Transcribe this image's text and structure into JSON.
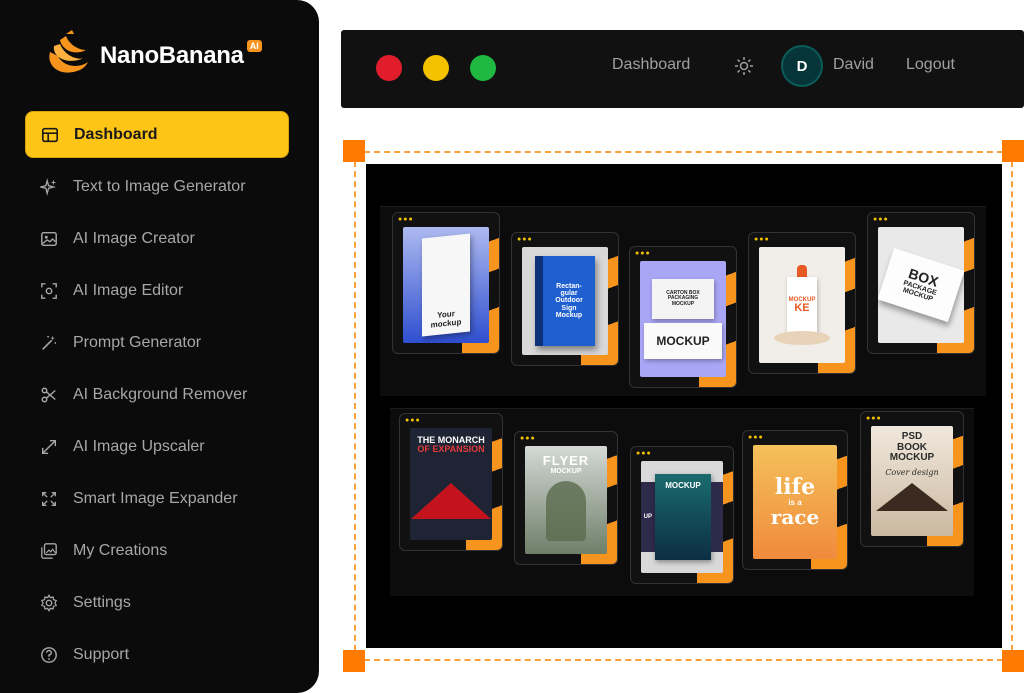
{
  "brand": {
    "name": "NanoBanana",
    "badge": "AI"
  },
  "sidebar": {
    "items": [
      {
        "label": "Dashboard",
        "icon": "dashboard-icon",
        "active": true
      },
      {
        "label": "Text to Image Generator",
        "icon": "sparkle-icon"
      },
      {
        "label": "AI Image Creator",
        "icon": "image-icon"
      },
      {
        "label": "AI Image Editor",
        "icon": "focus-icon"
      },
      {
        "label": "Prompt Generator",
        "icon": "magic-wand-icon"
      },
      {
        "label": "AI Background Remover",
        "icon": "scissors-icon"
      },
      {
        "label": "AI Image Upscaler",
        "icon": "expand-arrows-icon"
      },
      {
        "label": "Smart Image Expander",
        "icon": "maximize-icon"
      },
      {
        "label": "My Creations",
        "icon": "gallery-icon"
      },
      {
        "label": "Settings",
        "icon": "gear-icon"
      },
      {
        "label": "Support",
        "icon": "help-icon"
      }
    ]
  },
  "topbar": {
    "dashboard_link": "Dashboard",
    "avatar_initial": "D",
    "username": "David",
    "logout": "Logout"
  },
  "mockups": {
    "row1": [
      {
        "line1": "Your",
        "line2": "mockup"
      },
      {
        "line1": "Rectan-",
        "line2": "gular",
        "line3": "Outdoor",
        "line4": "Sign",
        "line5": "Mockup"
      },
      {
        "line1": "CARTON BOX",
        "line2": "PACKAGING",
        "line3": "MOCKUP",
        "line4": "MOCKUP"
      },
      {
        "line1": "MOCKUP",
        "line2": "KE"
      },
      {
        "line1": "BOX",
        "line2": "PACKAGE",
        "line3": "MOCKUP"
      }
    ],
    "row2": [
      {
        "line1": "THE MONARCH",
        "line2": "OF EXPANSION"
      },
      {
        "line1": "FLYER",
        "line2": "MOCKUP"
      },
      {
        "line1": "MOCKUP",
        "line2": "UP"
      },
      {
        "line1": "life",
        "line2": "is a",
        "line3": "race"
      },
      {
        "line1": "PSD",
        "line2": "BOOK",
        "line3": "MOCKUP",
        "line4": "Cover design"
      }
    ]
  },
  "colors": {
    "accent": "#fec517",
    "orange": "#f7941d",
    "sidebar_bg": "#0b0b0b",
    "topbar_bg": "#111111",
    "handle": "#ff7a00"
  }
}
